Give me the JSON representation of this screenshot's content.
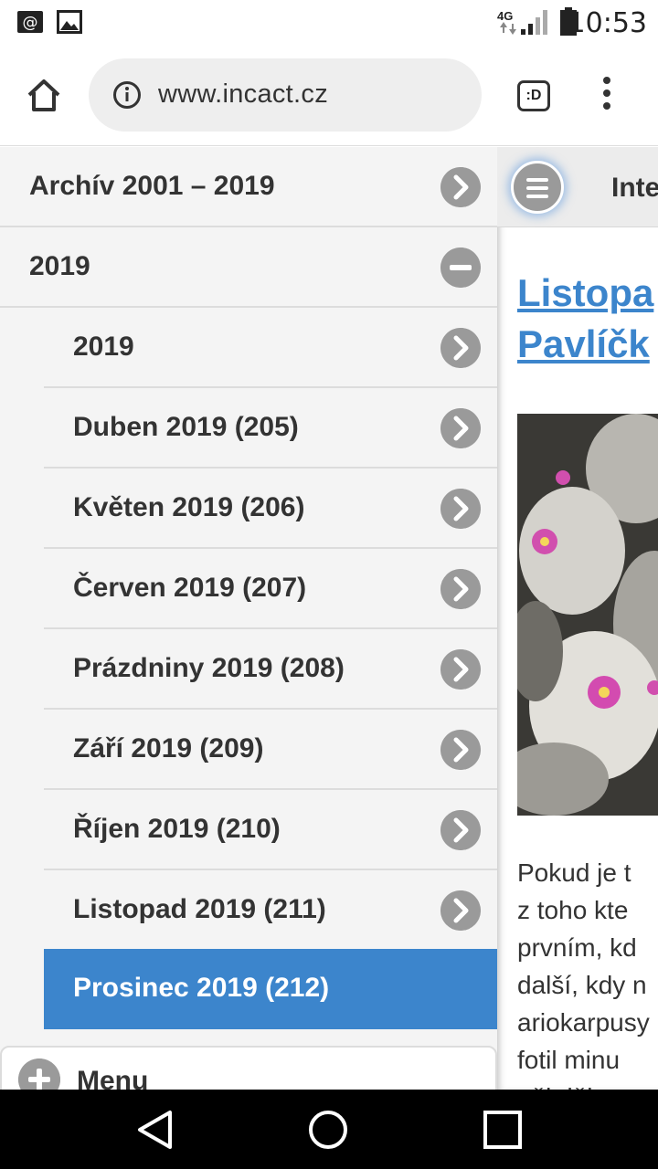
{
  "status_bar": {
    "time": "10:53",
    "network": "4G",
    "icons": [
      "email-notification-icon",
      "image-notification-icon",
      "signal-icon",
      "battery-icon"
    ]
  },
  "browser": {
    "url": "www.incact.cz",
    "tab_button_label": ":D"
  },
  "sidebar": {
    "top_items": [
      {
        "label": "Archív 2001 – 2019",
        "icon": "chevron-right-icon"
      },
      {
        "label": "2019",
        "icon": "minus-icon"
      }
    ],
    "sub_items": [
      {
        "label": "2019",
        "icon": "chevron-right-icon"
      },
      {
        "label": "Duben 2019 (205)",
        "icon": "chevron-right-icon"
      },
      {
        "label": "Květen 2019 (206)",
        "icon": "chevron-right-icon"
      },
      {
        "label": "Červen 2019 (207)",
        "icon": "chevron-right-icon"
      },
      {
        "label": "Prázdniny 2019 (208)",
        "icon": "chevron-right-icon"
      },
      {
        "label": "Září 2019 (209)",
        "icon": "chevron-right-icon"
      },
      {
        "label": "Říjen 2019 (210)",
        "icon": "chevron-right-icon"
      },
      {
        "label": "Listopad 2019 (211)",
        "icon": "chevron-right-icon"
      }
    ],
    "active_item": {
      "label": "Prosinec 2019 (212)"
    },
    "menu_label": "Menu"
  },
  "main": {
    "header_text": "Inte",
    "title_lines": [
      "Listopa",
      "Pavlíčk"
    ],
    "text_lines": [
      "Pokud je t",
      "z toho kte",
      "prvním, kd",
      "další, kdy n",
      "ariokarpusy",
      "fotil minu",
      "něj děl"
    ]
  },
  "colors": {
    "accent": "#3c85cc",
    "sidebar_bg": "#f4f4f4",
    "icon_circle": "#9a9a9a"
  }
}
